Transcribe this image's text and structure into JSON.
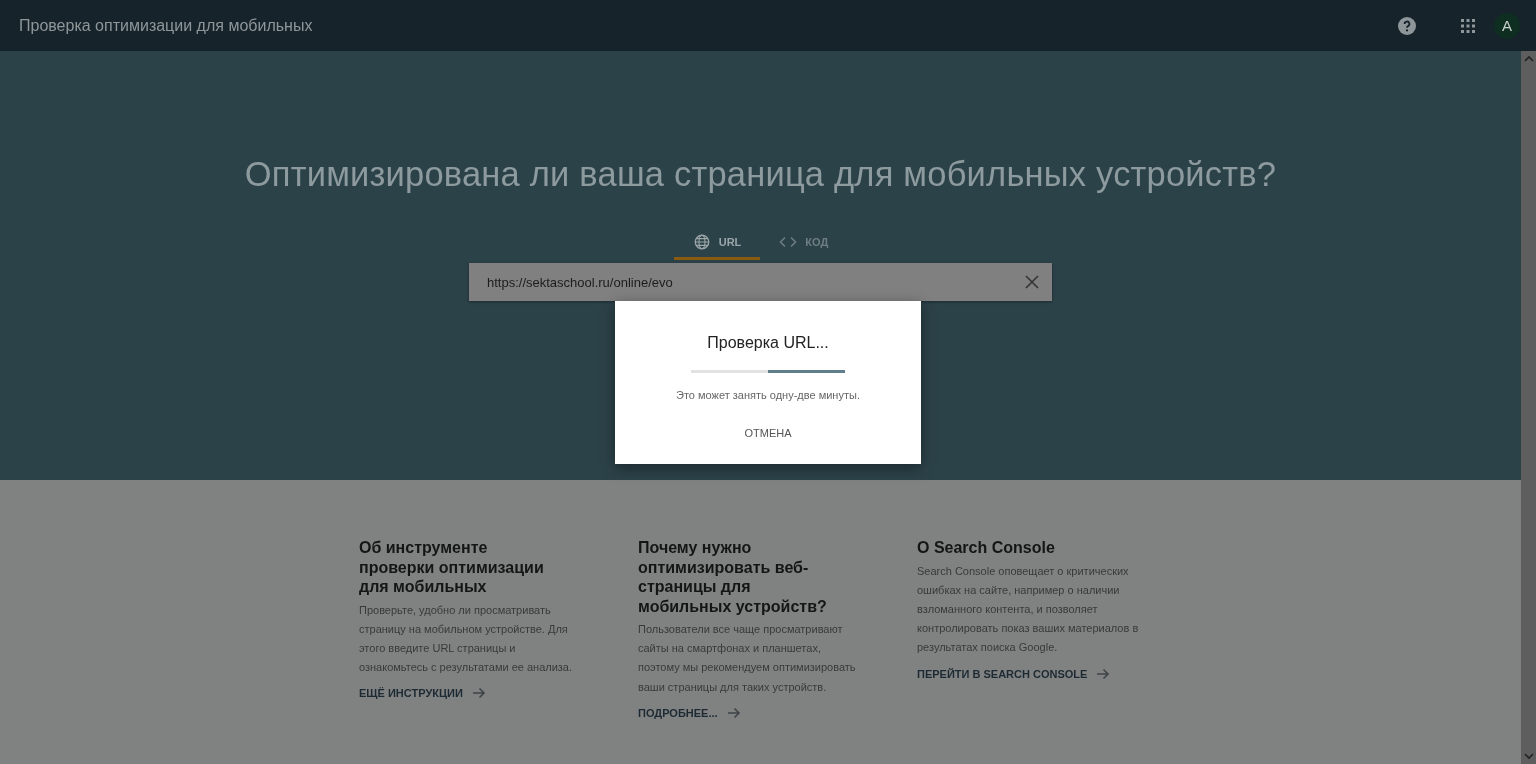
{
  "header": {
    "title": "Проверка оптимизации для мобильных",
    "avatar": "A"
  },
  "hero": {
    "headline": "Оптимизирована ли ваша страница для мобильных устройств?",
    "tabs": [
      {
        "kind": "globe",
        "label": "URL",
        "selected": true
      },
      {
        "kind": "code",
        "label": "КОД",
        "selected": false
      }
    ],
    "url_field": {
      "value": "https://sektaschool.ru/online/evo"
    }
  },
  "dialog": {
    "title": "Проверка URL...",
    "progress": {
      "level": 0.5
    },
    "message": "Это может занять одну-две минуты.",
    "cancel": "ОТМЕНА"
  },
  "columns": [
    {
      "heading": "Об инструменте проверки оптимизации для мобильных",
      "body": "Проверьте, удобно ли просматривать страницу на мобильном устройстве. Для этого введите URL страницы и ознакомьтесь с результатами ее анализа.",
      "link": "ЕЩЁ ИНСТРУКЦИИ"
    },
    {
      "heading": "Почему нужно оптимизировать веб-страницы для мобильных устройств?",
      "body": "Пользователи все чаще просматривают сайты на смартфонах и планшетах, поэтому мы рекомендуем оптимизировать ваши страницы для таких устройств.",
      "link": "ПОДРОБНЕЕ..."
    },
    {
      "heading": "О Search Console",
      "body": "Search Console оповещает о критических ошибках на сайте, например о наличии взломанного контента, и позволяет контролировать показ ваших материалов в результатах поиска Google.",
      "link": "ПЕРЕЙТИ В SEARCH CONSOLE"
    }
  ]
}
